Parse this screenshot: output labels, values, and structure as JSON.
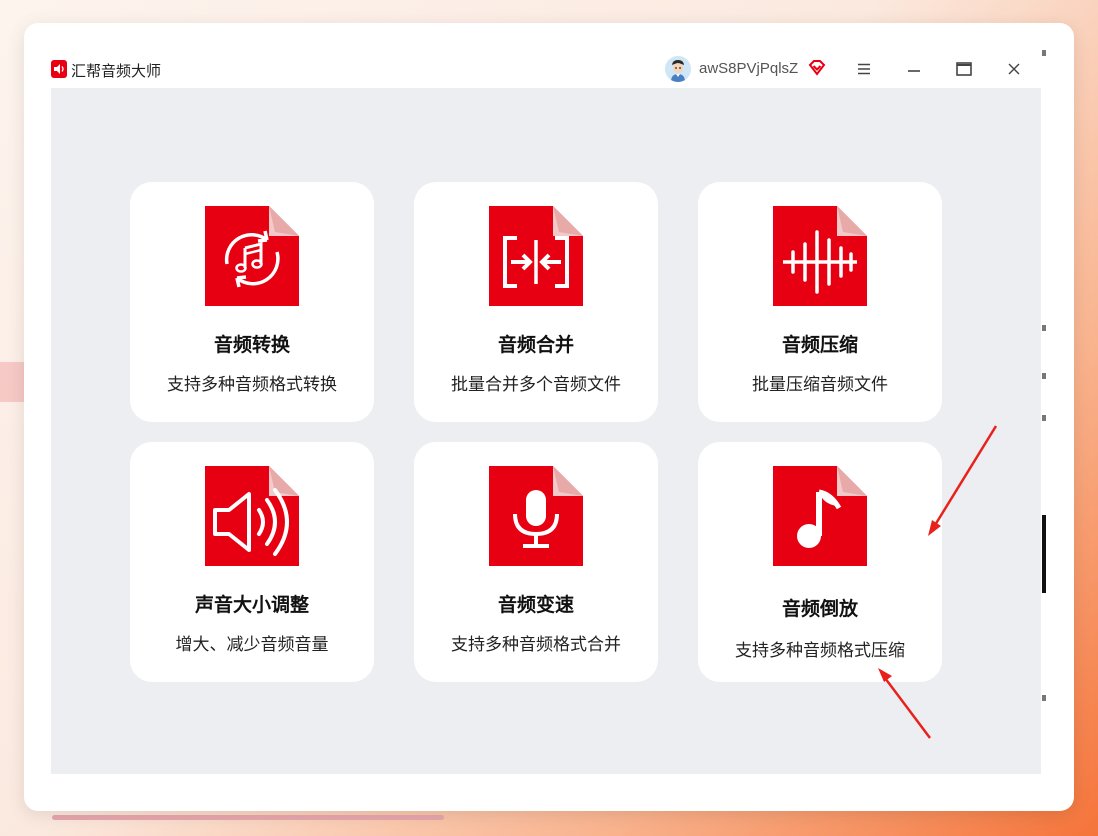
{
  "window": {
    "title": "汇帮音频大师",
    "username": "awS8PVjPqlsZ"
  },
  "colors": {
    "accent": "#e60012",
    "card_bg": "#ffffff",
    "panel_bg": "#edeef2",
    "arrow": "#e8221b"
  },
  "icons": {
    "app_logo": "speaker-logo-icon",
    "avatar": "user-avatar-icon",
    "vip": "vip-diamond-icon",
    "menu": "hamburger-menu-icon",
    "minimize": "minimize-icon",
    "maximize": "maximize-icon",
    "close": "close-icon"
  },
  "cards": [
    {
      "title": "音频转换",
      "desc": "支持多种音频格式转换",
      "icon": "music-convert-icon"
    },
    {
      "title": "音频合并",
      "desc": "批量合并多个音频文件",
      "icon": "merge-icon"
    },
    {
      "title": "音频压缩",
      "desc": "批量压缩音频文件",
      "icon": "waveform-icon"
    },
    {
      "title": "声音大小调整",
      "desc": "增大、减少音频音量",
      "icon": "volume-icon"
    },
    {
      "title": "音频变速",
      "desc": "支持多种音频格式合并",
      "icon": "microphone-icon"
    },
    {
      "title": "音频倒放",
      "desc": "支持多种音频格式压缩",
      "icon": "music-note-icon"
    }
  ]
}
